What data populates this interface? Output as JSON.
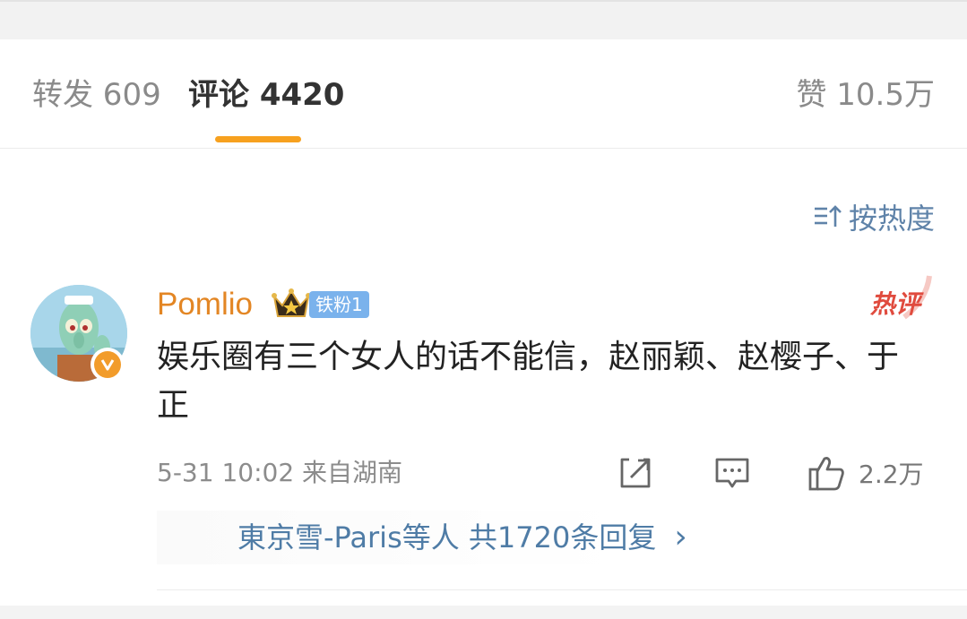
{
  "tabs": {
    "repost": "转发 609",
    "comments": "评论 4420",
    "likes": "赞 10.5万"
  },
  "sort": {
    "label": "按热度",
    "icon": "sort-icon"
  },
  "comment": {
    "username": "Pomlio",
    "fan_badge": "铁粉1",
    "hot_tag": "热评",
    "text": "娱乐圈有三个女人的话不能信，赵丽颖、赵樱子、于正",
    "meta": "5-31 10:02 来自湖南",
    "like_count": "2.2万",
    "icons": [
      "share-icon",
      "reply-icon",
      "thumbs-up-icon",
      "verified-icon",
      "crown-icon"
    ]
  },
  "replies": {
    "summary": "東京雪-Paris等人 共1720条回复",
    "chevron": "›"
  },
  "colors": {
    "accent": "#f7a11f",
    "username": "#e38624",
    "link": "#4f7ca6",
    "hot": "#e04b3e",
    "fan_badge": "#7ab2ec"
  }
}
